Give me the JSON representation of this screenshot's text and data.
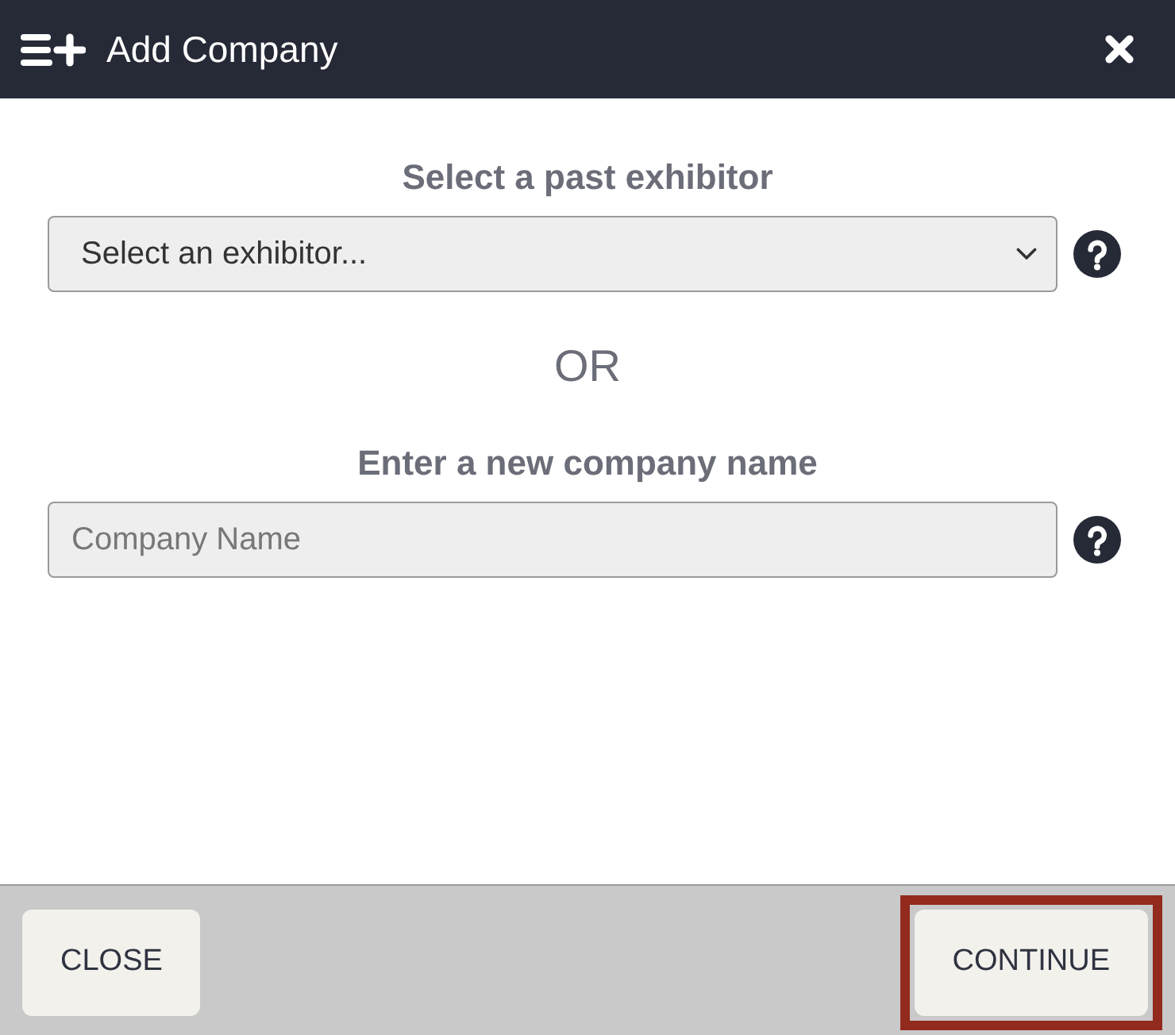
{
  "header": {
    "title": "Add Company"
  },
  "exhibitor_select": {
    "label": "Select a past exhibitor",
    "value": "Select an exhibitor..."
  },
  "separator": "OR",
  "company_name": {
    "label": "Enter a new company name",
    "placeholder": "Company Name"
  },
  "footer": {
    "buttons": [
      {
        "label": "CLOSE",
        "highlighted": false
      },
      {
        "label": "CONTINUE",
        "highlighted": true
      }
    ]
  }
}
